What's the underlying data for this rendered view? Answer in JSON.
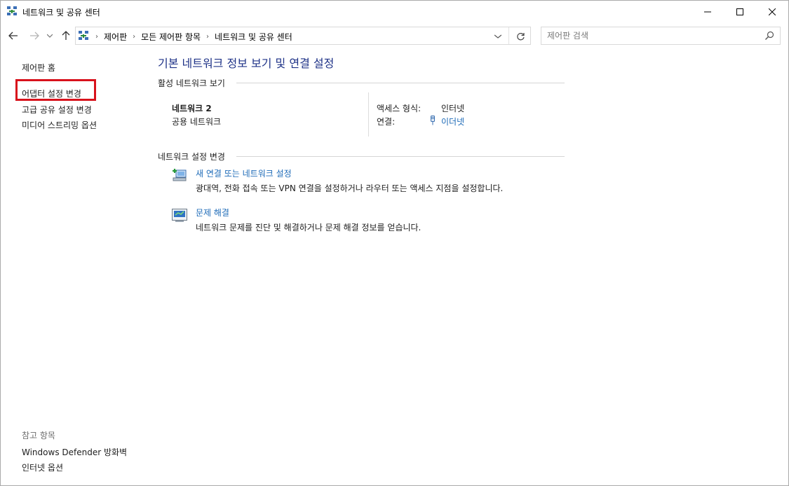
{
  "window": {
    "title": "네트워크 및 공유 센터",
    "controls": {
      "minimize": "minimize",
      "maximize": "maximize",
      "close": "close"
    }
  },
  "address_bar": {
    "breadcrumbs": [
      "제어판",
      "모든 제어판 항목",
      "네트워크 및 공유 센터"
    ],
    "search_placeholder": "제어판 검색"
  },
  "sidebar": {
    "links": [
      "제어판 홈",
      "어댑터 설정 변경",
      "고급 공유 설정 변경",
      "미디어 스트리밍 옵션"
    ],
    "highlighted_link": "어댑터 설정 변경",
    "see_also_title": "참고 항목",
    "see_also_links": [
      "Windows Defender 방화벽",
      "인터넷 옵션"
    ]
  },
  "main": {
    "heading": "기본 네트워크 정보 보기 및 연결 설정",
    "active_networks": {
      "title": "활성 네트워크 보기",
      "network_name": "네트워크 2",
      "network_category": "공용 네트워크",
      "access_type_label": "액세스 형식:",
      "access_type_value": "인터넷",
      "connections_label": "연결:",
      "connections_value": "이더넷"
    },
    "change_settings": {
      "title": "네트워크 설정 변경",
      "tasks": [
        {
          "title": "새 연결 또는 네트워크 설정",
          "description": "광대역, 전화 접속 또는 VPN 연결을 설정하거나 라우터 또는 액세스 지점을 설정합니다."
        },
        {
          "title": "문제 해결",
          "description": "네트워크 문제를 진단 및 해결하거나 문제 해결 정보를 얻습니다."
        }
      ]
    }
  },
  "colors": {
    "heading": "#1e3287",
    "link": "#1e6bb8",
    "highlight_box": "#d8121c"
  }
}
